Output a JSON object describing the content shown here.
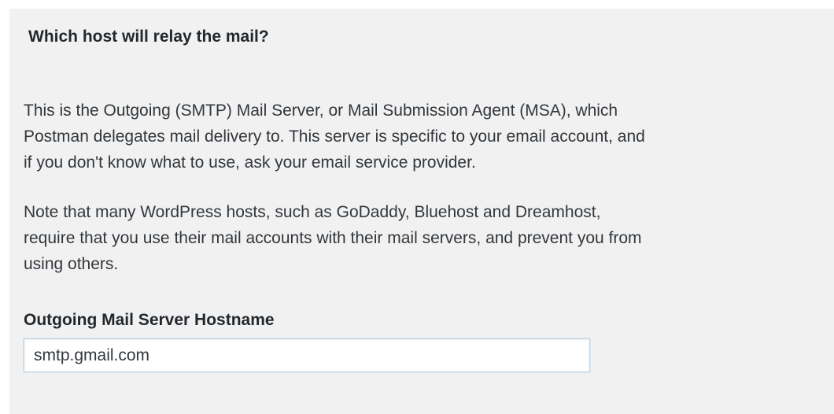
{
  "section": {
    "title": "Which host will relay the mail?",
    "description_lines": [
      "This is the Outgoing (SMTP) Mail Server, or Mail Submission Agent (MSA), which",
      "Postman delegates mail delivery to. This server is specific to your email account, and",
      "if you don't know what to use, ask your email service provider."
    ],
    "note_lines": [
      "Note that many WordPress hosts, such as GoDaddy, Bluehost and Dreamhost,",
      "require that you use their mail accounts with their mail servers, and prevent you from",
      "using others."
    ]
  },
  "hostname_field": {
    "label": "Outgoing Mail Server Hostname",
    "value": "smtp.gmail.com"
  }
}
